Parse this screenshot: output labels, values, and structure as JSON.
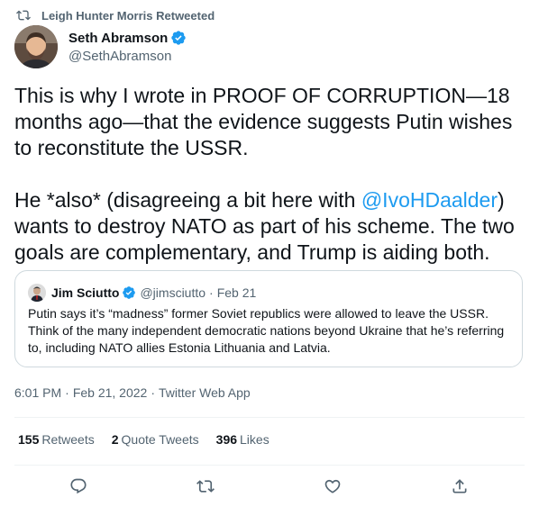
{
  "retweet_banner": {
    "text": "Leigh Hunter Morris Retweeted",
    "icon": "retweet-icon"
  },
  "author": {
    "display_name": "Seth Abramson",
    "handle": "@SethAbramson",
    "verified": true
  },
  "tweet": {
    "para1": "This is why I wrote in PROOF OF CORRUPTION—18 months ago—that the evidence suggests Putin wishes to reconstitute the USSR.",
    "para2_before": "He *also* (disagreeing a bit here with ",
    "mention": "@IvoHDaalder",
    "para2_after": ") wants to destroy NATO as part of his scheme. The two goals are complementary, and Trump is aiding both."
  },
  "quote": {
    "display_name": "Jim Sciutto",
    "handle": "@jimsciutto",
    "separator": "·",
    "date": "Feb 21",
    "text": "Putin says it’s “madness” former Soviet republics were allowed to leave the USSR. Think of the many independent democratic nations beyond Ukraine that he’s referring to, including NATO allies Estonia Lithuania and Latvia."
  },
  "meta": {
    "time": "6:01 PM",
    "sep1": "·",
    "date": "Feb 21, 2022",
    "sep2": "·",
    "source": "Twitter Web App"
  },
  "stats": {
    "retweets_count": "155",
    "retweets_label": "Retweets",
    "quotes_count": "2",
    "quotes_label": "Quote Tweets",
    "likes_count": "396",
    "likes_label": "Likes"
  },
  "actions": [
    "reply-icon",
    "retweet-icon",
    "like-icon",
    "share-icon"
  ],
  "colors": {
    "accent": "#1d9bf0",
    "muted": "#536471",
    "text": "#0f1419",
    "border": "#cfd9de"
  }
}
